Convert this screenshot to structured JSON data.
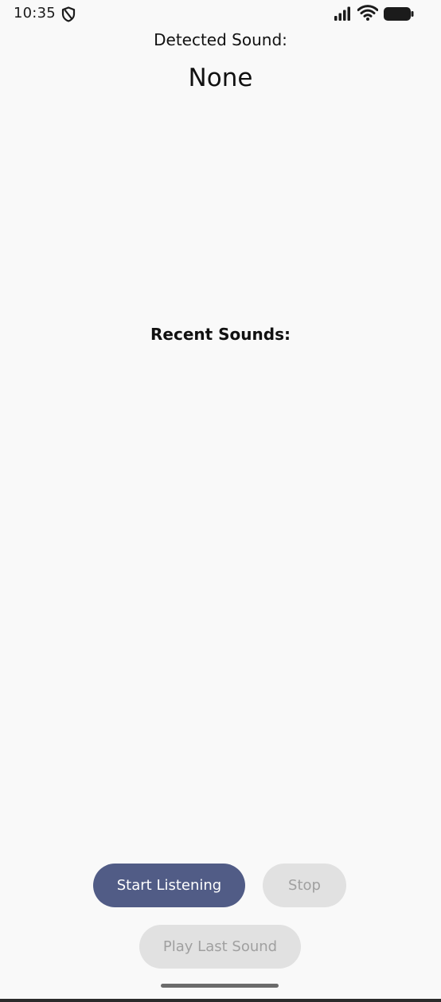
{
  "status_bar": {
    "time": "10:35"
  },
  "main": {
    "detected_label": "Detected Sound:",
    "detected_value": "None",
    "recent_label": "Recent Sounds:",
    "recent_items": []
  },
  "buttons": {
    "start_label": "Start Listening",
    "stop_label": "Stop",
    "play_last_label": "Play Last Sound"
  },
  "colors": {
    "accent": "#515c86",
    "disabled_bg": "#e1e1e1",
    "disabled_text": "#a0a0a0",
    "background": "#f9f9f9"
  }
}
